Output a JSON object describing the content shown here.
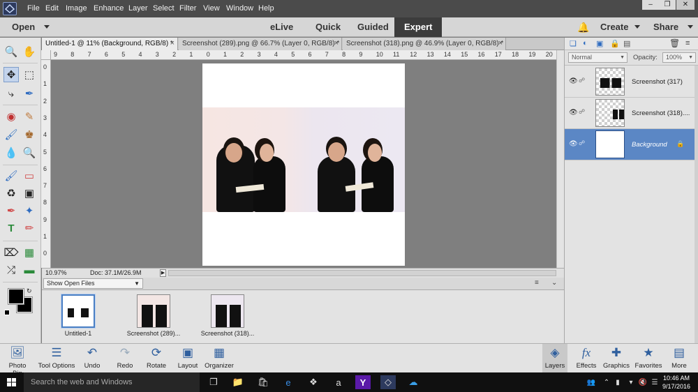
{
  "menubar": {
    "items": [
      "File",
      "Edit",
      "Image",
      "Enhance",
      "Layer",
      "Select",
      "Filter",
      "View",
      "Window",
      "Help"
    ]
  },
  "modebar": {
    "open_label": "Open",
    "modes": [
      "eLive",
      "Quick",
      "Guided",
      "Expert"
    ],
    "active_mode": "Expert",
    "create_label": "Create",
    "share_label": "Share"
  },
  "tabs": [
    "Untitled-1 @ 11% (Background, RGB/8) *",
    "Screenshot (289).png @ 66.7% (Layer 0, RGB/8) *",
    "Screenshot (318).png @ 46.9% (Layer 0, RGB/8) *"
  ],
  "rulers": {
    "horizontal": [
      "9",
      "8",
      "7",
      "6",
      "5",
      "4",
      "3",
      "2",
      "1",
      "0",
      "1",
      "2",
      "3",
      "4",
      "5",
      "6",
      "7",
      "8",
      "9",
      "10",
      "11",
      "12",
      "13",
      "14",
      "15",
      "16",
      "17",
      "18",
      "19",
      "20"
    ],
    "vertical": [
      "0",
      "1",
      "2",
      "3",
      "4",
      "5",
      "6",
      "7",
      "8",
      "9",
      "1",
      "0",
      "1",
      "1"
    ]
  },
  "status": {
    "zoom": "10.97%",
    "doc": "Doc: 37.1M/26.9M"
  },
  "photobin": {
    "filter_label": "Show Open Files",
    "items": [
      {
        "label": "Untitled-1"
      },
      {
        "label": "Screenshot (289)..."
      },
      {
        "label": "Screenshot (318)..."
      }
    ]
  },
  "layers_panel": {
    "blend_mode": "Normal",
    "opacity_label": "Opacity:",
    "opacity_value": "100%",
    "layers": [
      {
        "name": "Screenshot (317)"
      },
      {
        "name": "Screenshot (318)...."
      },
      {
        "name": "Background"
      }
    ]
  },
  "taskbar": {
    "left": [
      "Photo Bin",
      "Tool Options",
      "Undo",
      "Redo",
      "Rotate",
      "Layout",
      "Organizer"
    ],
    "right": [
      "Layers",
      "Effects",
      "Graphics",
      "Favorites",
      "More"
    ]
  },
  "windows": {
    "search_placeholder": "Search the web and Windows",
    "time": "10:46 AM",
    "date": "9/17/2016"
  }
}
